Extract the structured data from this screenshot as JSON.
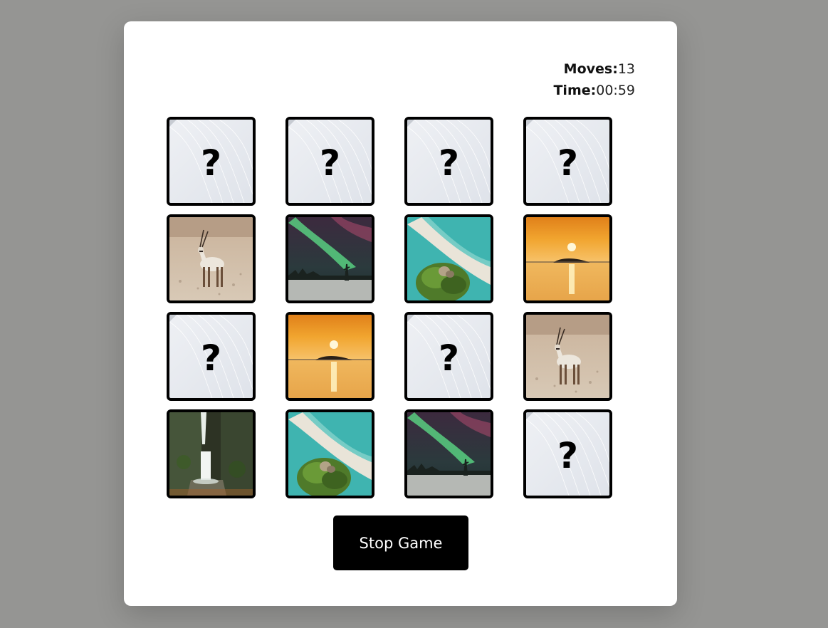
{
  "stats": {
    "moves_label": "Moves:",
    "moves_value": "13",
    "time_label": "Time:",
    "time_value": "00:59"
  },
  "board": {
    "hidden_symbol": "?",
    "cards": [
      {
        "state": "hidden"
      },
      {
        "state": "hidden"
      },
      {
        "state": "hidden"
      },
      {
        "state": "hidden"
      },
      {
        "state": "revealed",
        "image": "oryx"
      },
      {
        "state": "revealed",
        "image": "aurora"
      },
      {
        "state": "revealed",
        "image": "beach"
      },
      {
        "state": "revealed",
        "image": "sunset"
      },
      {
        "state": "hidden"
      },
      {
        "state": "revealed",
        "image": "sunset"
      },
      {
        "state": "hidden"
      },
      {
        "state": "revealed",
        "image": "oryx"
      },
      {
        "state": "revealed",
        "image": "waterfall"
      },
      {
        "state": "revealed",
        "image": "beach"
      },
      {
        "state": "revealed",
        "image": "aurora"
      },
      {
        "state": "hidden"
      }
    ]
  },
  "controls": {
    "stop_label": "Stop Game"
  }
}
